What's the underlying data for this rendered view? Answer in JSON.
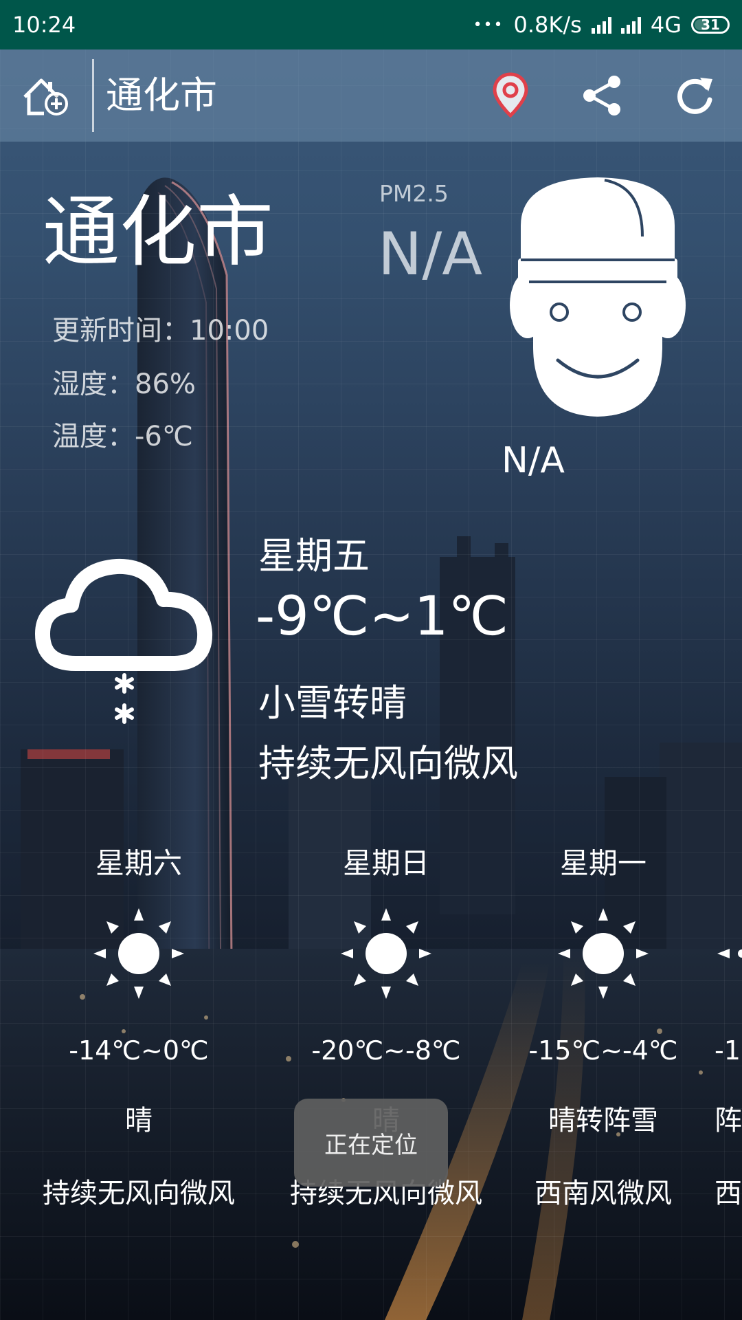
{
  "status_bar": {
    "time": "10:24",
    "dots": "•••",
    "net_speed": "0.8K/s",
    "network": "4G",
    "battery": "31"
  },
  "app_bar": {
    "city": "通化市",
    "icons": [
      "add-home-icon",
      "location-pin-icon",
      "share-icon",
      "refresh-icon"
    ],
    "location_icon_color": "#e0404a"
  },
  "current": {
    "city": "通化市",
    "update_time": "更新时间：10:00",
    "humidity": "湿度：86%",
    "temperature": "温度：-6℃",
    "pm_label": "PM2.5",
    "pm_value": "N/A",
    "aqi_label": "N/A",
    "face_icon": "smiley-face-icon"
  },
  "today": {
    "day": "星期五",
    "temp_range": "-9℃~1℃",
    "condition": "小雪转晴",
    "wind": "持续无风向微风",
    "icon": "cloud-snow-icon"
  },
  "forecast": [
    {
      "day": "星期六",
      "temp": "-14℃~0℃",
      "condition": "晴",
      "wind": "持续无风向微风",
      "icon": "sun-icon"
    },
    {
      "day": "星期日",
      "temp": "-20℃~-8℃",
      "condition": "晴",
      "wind": "持续无风向微风",
      "icon": "sun-icon"
    },
    {
      "day": "星期一",
      "temp": "-15℃~-4℃",
      "condition": "晴转阵雪",
      "wind": "西南风微风",
      "icon": "sun-icon"
    },
    {
      "day": "",
      "temp": "-1",
      "condition": "阵",
      "wind": "西",
      "icon": "sun-icon"
    }
  ],
  "toast": "正在定位",
  "colors": {
    "status_bar": "#00564a",
    "app_bar": "#6e8caa",
    "text": "#ffffff"
  }
}
